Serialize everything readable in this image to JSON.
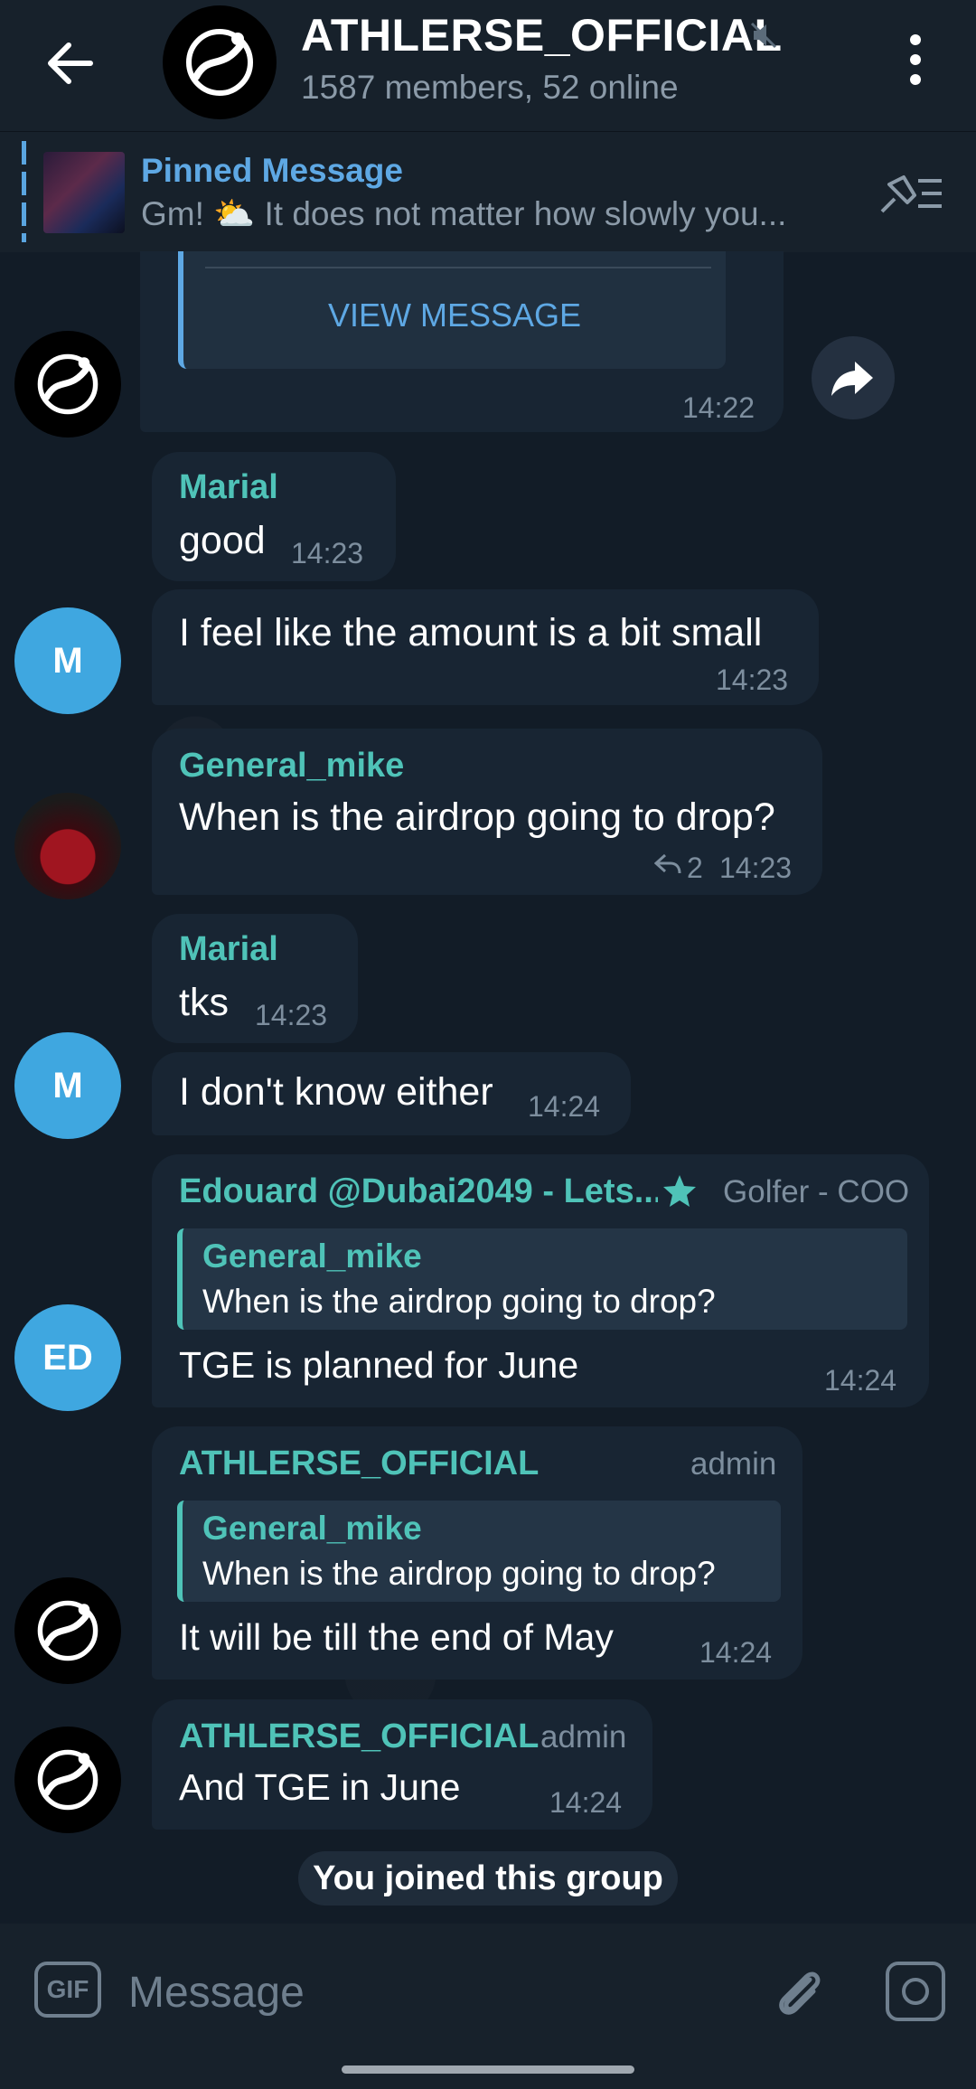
{
  "header": {
    "title": "ATHLERSE_OFFICIAL",
    "subtitle": "1587 members, 52 online"
  },
  "pinned": {
    "title": "Pinned Message",
    "text": "Gm! ⛅ It does not matter how slowly you..."
  },
  "messages": {
    "m0": {
      "button": "VIEW MESSAGE",
      "time": "14:22"
    },
    "m1": {
      "sender": "Marial",
      "text": "good",
      "time": "14:23"
    },
    "m2": {
      "text": "I feel like the amount is a bit small",
      "time": "14:23"
    },
    "m3": {
      "sender": "General_mike",
      "text": "When is the airdrop going to drop?",
      "replies": "2",
      "time": "14:23"
    },
    "m4": {
      "sender": "Marial",
      "text": "tks",
      "time": "14:23"
    },
    "m5": {
      "text": "I don't know either",
      "time": "14:24"
    },
    "m6": {
      "sender": "Edouard @Dubai2049 - Lets...",
      "role": "Golfer - COO",
      "quote_name": "General_mike",
      "quote_text": "When is the airdrop going to drop?",
      "text": "TGE is planned for June",
      "time": "14:24"
    },
    "m7": {
      "sender": "ATHLERSE_OFFICIAL",
      "role": "admin",
      "quote_name": "General_mike",
      "quote_text": "When is the airdrop going to drop?",
      "text": "It will be till the end of May",
      "time": "14:24"
    },
    "m8": {
      "sender": "ATHLERSE_OFFICIAL",
      "role": "admin",
      "text": "And TGE in June",
      "time": "14:24"
    }
  },
  "avatars": {
    "marial": "M",
    "edouard": "ED"
  },
  "system": {
    "joined": "You joined this group"
  },
  "composer": {
    "placeholder": "Message",
    "gif_label": "GIF"
  },
  "colors": {
    "accent": "#5ea8e4",
    "sender": "#4fc3b8",
    "bubble": "#182533",
    "background": "#0e1621"
  }
}
